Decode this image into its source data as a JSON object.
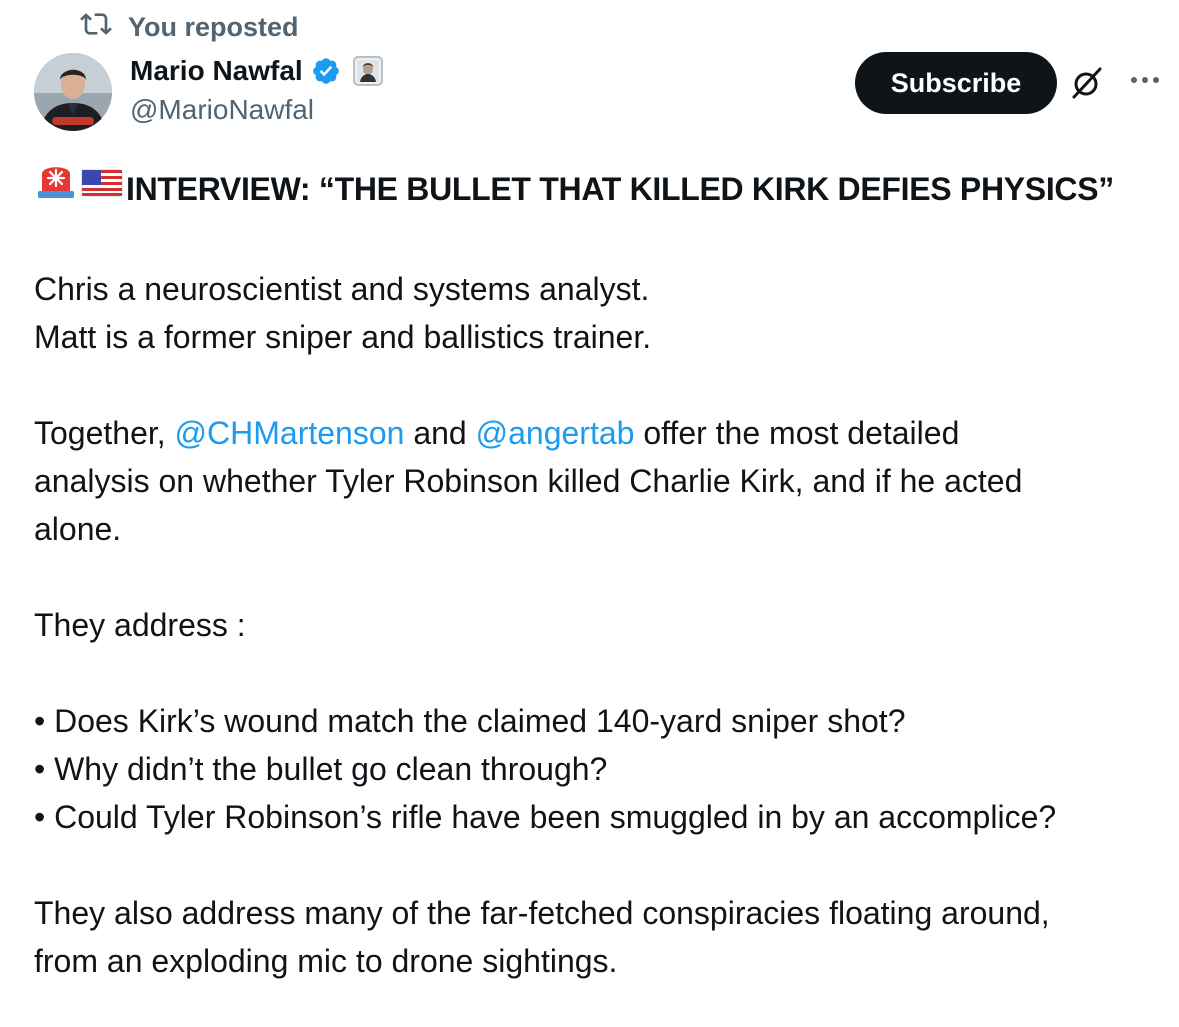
{
  "repost": {
    "icon": "repost-icon",
    "label": "You reposted"
  },
  "author": {
    "name": "Mario Nawfal",
    "handle": "@MarioNawfal",
    "verified_icon": "verified-badge-icon",
    "affiliate_icon": "affiliate-badge-icon",
    "avatar_icon": "avatar"
  },
  "actions": {
    "subscribe_label": "Subscribe",
    "grok_icon": "grok-icon",
    "more_icon": "more-icon"
  },
  "post": {
    "headline": "INTERVIEW: “THE BULLET THAT KILLED KIRK DEFIES PHYSICS”",
    "headline_icons": [
      "siren-emoji",
      "us-flag-emoji"
    ],
    "line1": "Chris a neuroscientist and systems analyst.",
    "line2": "Matt is a former sniper and ballistics trainer.",
    "together_prefix": "Together, ",
    "mention1": "@CHMartenson",
    "together_and": " and ",
    "mention2": "@angertab",
    "together_rest_1": " offer the most detailed",
    "together_rest_2": "analysis on whether Tyler Robinson killed Charlie Kirk, and if he acted",
    "together_rest_3": "alone.",
    "address_intro": "They address :",
    "bullets": [
      "• Does Kirk’s wound match the claimed 140-yard sniper shot?",
      "• Why didn’t the bullet go clean through?",
      "• Could Tyler Robinson’s rifle have been smuggled in by an accomplice?"
    ],
    "closing_1": "They also address many of the far-fetched conspiracies floating around,",
    "closing_2": "from an exploding mic to drone sightings."
  },
  "colors": {
    "text": "#0f1419",
    "secondary": "#536471",
    "link": "#1d9bf0",
    "verified": "#1d9bf0",
    "button_bg": "#0f1419"
  }
}
